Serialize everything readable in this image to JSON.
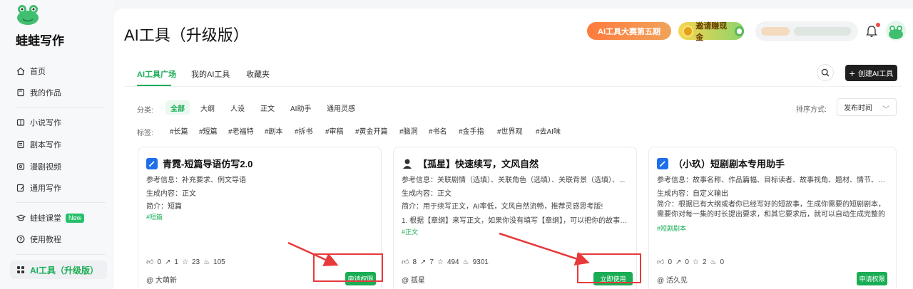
{
  "brand": {
    "name": "蛙蛙写作"
  },
  "sidebar": {
    "items": [
      {
        "label": "首页"
      },
      {
        "label": "我的作品"
      },
      {
        "label": "小说写作"
      },
      {
        "label": "剧本写作"
      },
      {
        "label": "漫剧视频"
      },
      {
        "label": "通用写作"
      },
      {
        "label": "蛙蛙课堂",
        "badge": "New"
      },
      {
        "label": "使用教程"
      },
      {
        "label": "AI工具（升级版）"
      }
    ]
  },
  "header": {
    "title": "AI工具（升级版）",
    "promo": "AI工具大赛第五期",
    "invite": "邀请赚现金"
  },
  "tabs": [
    {
      "label": "AI工具广场"
    },
    {
      "label": "我的AI工具"
    },
    {
      "label": "收藏夹"
    }
  ],
  "actions": {
    "create_label": "创建AI工具"
  },
  "filters": {
    "category_label": "分类:",
    "categories": [
      "全部",
      "大纲",
      "人设",
      "正文",
      "AI助手",
      "通用灵感"
    ],
    "tag_label": "标签:",
    "tags": [
      "#长篇",
      "#短篇",
      "#老福特",
      "#剧本",
      "#拆书",
      "#审稿",
      "#黄金开篇",
      "#脑洞",
      "#书名",
      "#金手指",
      "#世界观",
      "#去AI味"
    ],
    "sort_label": "排序方式:",
    "sort_value": "发布时间"
  },
  "cards": [
    {
      "title": "青霓-短篇导语仿写2.0",
      "ref": "参考信息：补充要求、例文导语",
      "gen": "生成内容：正文",
      "intro": "简介：短篇",
      "tag": "#短篇",
      "likes": "0",
      "shares": "1",
      "stars": "23",
      "uses": "105",
      "author": "@ 大萌新",
      "button": "申请权限"
    },
    {
      "title": "【孤星】快速续写，文风自然",
      "ref": "参考信息：关联剧情（选填）、关联角色（选填）、关联背景（选填）、...",
      "gen": "生成内容：正文",
      "intro": "简介：用于续写正文，AI率低，文风自然流畅，推荐灵感思考版!",
      "detail": "1. 根据【章纲】来写正文，如果你没有填写【章纲】，可以把你的故事方...",
      "tag": "#正文",
      "likes": "8",
      "shares": "7",
      "stars": "494",
      "uses": "9301",
      "author": "@ 孤星",
      "button": "立即使用"
    },
    {
      "title": "（小玖）短剧剧本专用助手",
      "ref": "参考信息：故事名称、作品篇幅、目标读者、故事视角、题材、情节、情...",
      "gen": "生成内容：自定义输出",
      "intro": "简介：根据已有大纲或者你已经写好的短故事，生成你需要的短剧剧本，需要你对每一集的时长提出要求，和其它要求后，就可以自动生成完整的剧...",
      "tag": "#短剧剧本",
      "likes": "0",
      "shares": "0",
      "stars": "2",
      "uses": "0",
      "author": "@ 活久见",
      "button": "申请权限"
    }
  ],
  "colors": {
    "accent": "#1aad55",
    "annotation": "#e8393b",
    "promo": "#ff7a3d"
  }
}
